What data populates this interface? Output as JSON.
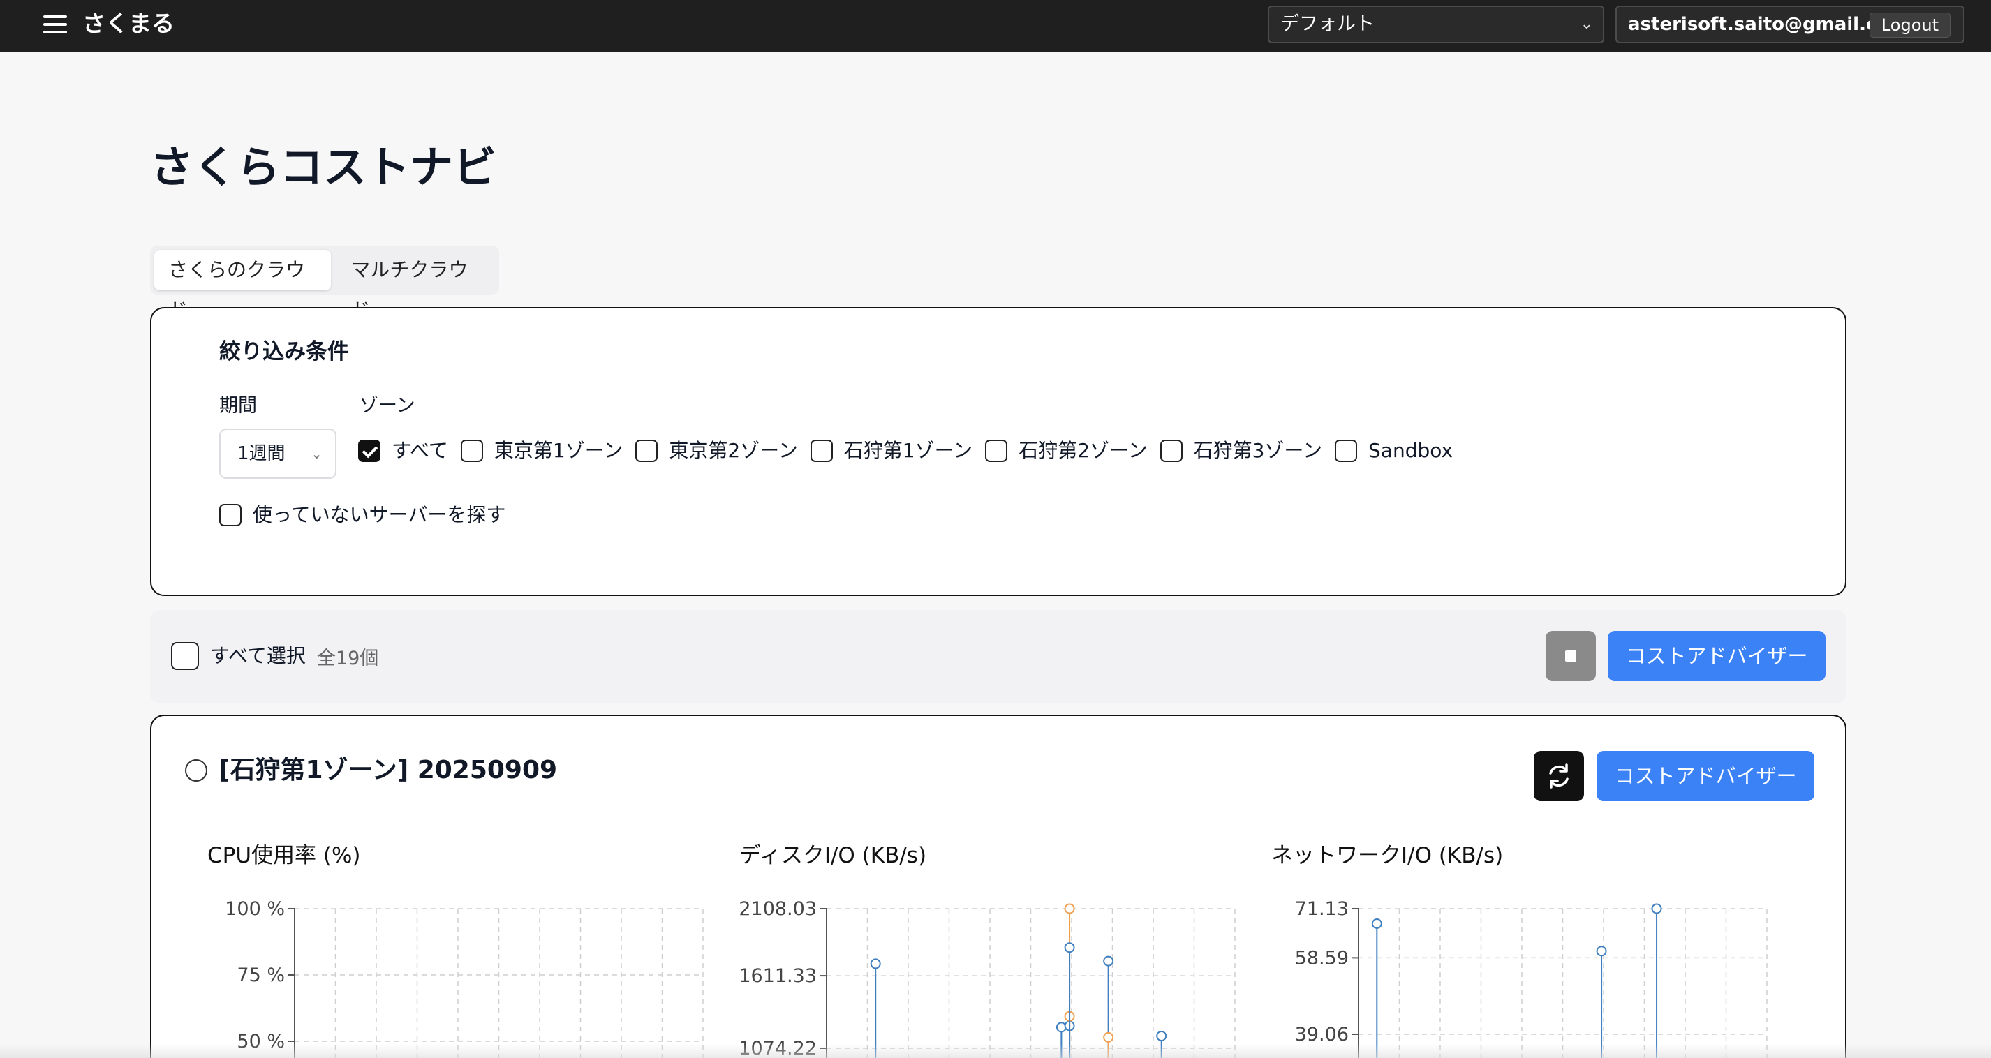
{
  "header": {
    "brand": "さくまる",
    "workspace": "デフォルト",
    "user_email": "asterisoft.saito@gmail.com",
    "logout_label": "Logout"
  },
  "page": {
    "title": "さくらコストナビ",
    "tabs": [
      {
        "label": "さくらのクラウド",
        "active": true
      },
      {
        "label": "マルチクラウド",
        "active": false
      }
    ]
  },
  "filter": {
    "heading": "絞り込み条件",
    "period_label": "期間",
    "period_value": "1週間",
    "zone_label": "ゾーン",
    "zones": [
      {
        "label": "すべて",
        "checked": true
      },
      {
        "label": "東京第1ゾーン",
        "checked": false
      },
      {
        "label": "東京第2ゾーン",
        "checked": false
      },
      {
        "label": "石狩第1ゾーン",
        "checked": false
      },
      {
        "label": "石狩第2ゾーン",
        "checked": false
      },
      {
        "label": "石狩第3ゾーン",
        "checked": false
      },
      {
        "label": "Sandbox",
        "checked": false
      }
    ],
    "unused_label": "使っていないサーバーを探す"
  },
  "toolbar": {
    "select_all_label": "すべて選択",
    "count_label": "全19個",
    "advisor_label": "コストアドバイザー"
  },
  "server": {
    "title": "[石狩第1ゾーン] 20250909",
    "advisor_label": "コストアドバイザー"
  },
  "colors": {
    "accent": "#3b82f6",
    "series_blue": "#3f7fbf",
    "series_orange": "#f0a050"
  },
  "chart_data": [
    {
      "type": "scatter",
      "title": "CPU使用率 (%)",
      "y_ticks": [
        "100 %",
        "75 %",
        "50 %"
      ],
      "y_tick_values": [
        100,
        75,
        50
      ],
      "ylim": [
        50,
        100
      ],
      "grid": true,
      "series": []
    },
    {
      "type": "scatter",
      "title": "ディスクI/O (KB/s)",
      "y_ticks": [
        "2108.03",
        "1611.33",
        "1074.22"
      ],
      "y_tick_values": [
        2108.03,
        1611.33,
        1074.22
      ],
      "ylim": [
        1074.22,
        2108.03
      ],
      "grid": true,
      "x_count": 10,
      "series": [
        {
          "color": "#3f7fbf",
          "points": [
            {
              "x": 1.2,
              "y": 1700
            },
            {
              "x": 5.75,
              "y": 1230
            },
            {
              "x": 5.95,
              "y": 1240
            },
            {
              "x": 6.9,
              "y": 1720
            },
            {
              "x": 8.2,
              "y": 1165
            }
          ]
        },
        {
          "color": "#f0a050",
          "points": [
            {
              "x": 5.95,
              "y": 2108.03
            },
            {
              "x": 5.95,
              "y": 1311
            },
            {
              "x": 6.9,
              "y": 1155
            }
          ]
        },
        {
          "color": "#3f7fbf",
          "points": [
            {
              "x": 5.95,
              "y": 1820
            }
          ]
        }
      ]
    },
    {
      "type": "scatter",
      "title": "ネットワークI/O (KB/s)",
      "y_ticks": [
        "71.13",
        "58.59",
        "39.06"
      ],
      "y_tick_values": [
        71.13,
        58.59,
        39.06
      ],
      "ylim": [
        39.06,
        71.13
      ],
      "grid": true,
      "x_count": 10,
      "series": [
        {
          "color": "#3f7fbf",
          "points": [
            {
              "x": 0.45,
              "y": 67.3
            },
            {
              "x": 5.95,
              "y": 60.3
            },
            {
              "x": 7.3,
              "y": 71.13
            }
          ]
        }
      ]
    }
  ]
}
